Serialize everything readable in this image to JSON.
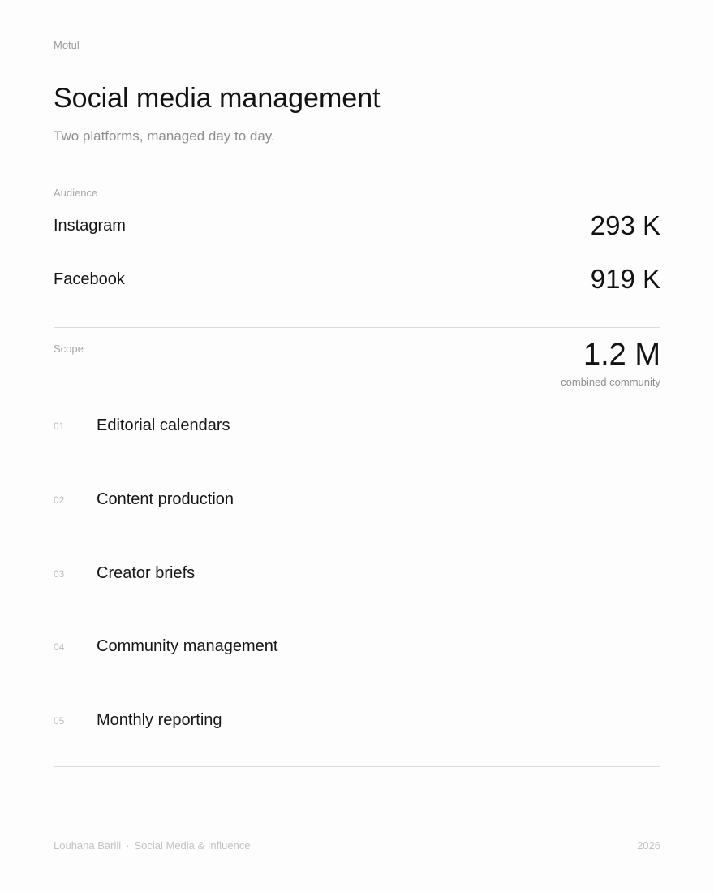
{
  "header": {
    "client": "Motul",
    "title": "Social media management",
    "subtitle": "Two platforms, managed day to day."
  },
  "audience": {
    "label": "Audience",
    "platforms": [
      {
        "name": "Instagram",
        "value": "293 K"
      },
      {
        "name": "Facebook",
        "value": "919 K"
      }
    ]
  },
  "scope": {
    "label": "Scope",
    "total": "1.2 M",
    "total_caption": "combined community",
    "items": [
      {
        "num": "01",
        "label": "Editorial calendars"
      },
      {
        "num": "02",
        "label": "Content production"
      },
      {
        "num": "03",
        "label": "Creator briefs"
      },
      {
        "num": "04",
        "label": "Community management"
      },
      {
        "num": "05",
        "label": "Monthly reporting"
      }
    ]
  },
  "footer": {
    "author": "Louhana Barili",
    "separator": "·",
    "practice": "Social Media & Influence",
    "year": "2026"
  }
}
